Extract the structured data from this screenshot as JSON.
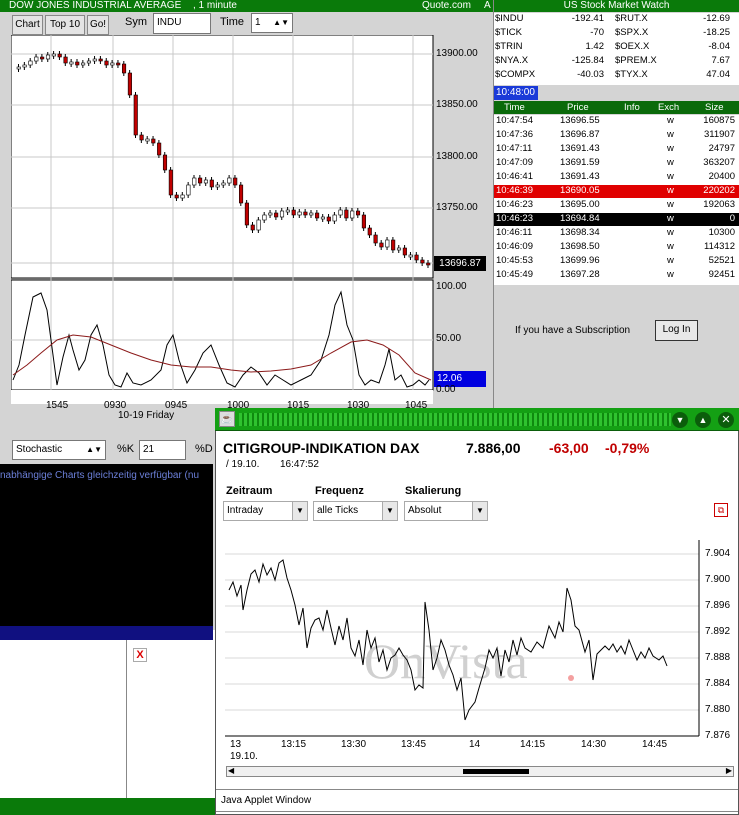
{
  "chart_window": {
    "title": "DOW JONES INDUSTRIAL AVERAGE",
    "interval": ", 1 minute",
    "source": "Quote.com",
    "source_suffix": "A",
    "toolbar": {
      "chart_btn": "Chart",
      "top10_btn": "Top 10",
      "go_btn": "Go!",
      "sym_label": "Sym",
      "sym_value": "INDU",
      "time_label": "Time",
      "time_value": "1"
    },
    "price_ticks": [
      "13900.00",
      "13850.00",
      "13800.00",
      "13750.00"
    ],
    "last_price": "13696.87",
    "osc_ticks": [
      "100.00",
      "50.00",
      "0.00"
    ],
    "osc_value": "12.06",
    "x_ticks": [
      "1545",
      "0930",
      "0945",
      "1000",
      "1015",
      "1030",
      "1045"
    ],
    "date_label": "10-19 Friday",
    "indicator": {
      "name": "Stochastic",
      "k_label": "%K",
      "k_value": "21",
      "d_label": "%D"
    },
    "info_text": "nabhängige Charts gleichzeitig verfügbar (nu"
  },
  "market_watch": {
    "title": "US Stock Market Watch",
    "rows": [
      {
        "s1": "$INDU",
        "v1": "-192.41",
        "s2": "$RUT.X",
        "v2": "-12.69"
      },
      {
        "s1": "$TICK",
        "v1": "-70",
        "s2": "$SPX.X",
        "v2": "-18.25"
      },
      {
        "s1": "$TRIN",
        "v1": "1.42",
        "s2": "$OEX.X",
        "v2": "-8.04"
      },
      {
        "s1": "$NYA.X",
        "v1": "-125.84",
        "s2": "$PREM.X",
        "v2": "7.67"
      },
      {
        "s1": "$COMPX",
        "v1": "-40.03",
        "s2": "$TYX.X",
        "v2": "47.04"
      }
    ],
    "clock": "10:48:00",
    "headers": [
      "Time",
      "Price",
      "Info",
      "Exch",
      "Size"
    ],
    "trades": [
      {
        "time": "10:47:54",
        "price": "13696.55",
        "exch": "w",
        "size": "160875",
        "hl": ""
      },
      {
        "time": "10:47:36",
        "price": "13696.87",
        "exch": "w",
        "size": "311907",
        "hl": ""
      },
      {
        "time": "10:47:11",
        "price": "13691.43",
        "exch": "w",
        "size": "24797",
        "hl": ""
      },
      {
        "time": "10:47:09",
        "price": "13691.59",
        "exch": "w",
        "size": "363207",
        "hl": ""
      },
      {
        "time": "10:46:41",
        "price": "13691.43",
        "exch": "w",
        "size": "20400",
        "hl": ""
      },
      {
        "time": "10:46:39",
        "price": "13690.05",
        "exch": "w",
        "size": "220202",
        "hl": "red"
      },
      {
        "time": "10:46:23",
        "price": "13695.00",
        "exch": "w",
        "size": "192063",
        "hl": ""
      },
      {
        "time": "10:46:23",
        "price": "13694.84",
        "exch": "w",
        "size": "0",
        "hl": "black"
      },
      {
        "time": "10:46:11",
        "price": "13698.34",
        "exch": "w",
        "size": "10300",
        "hl": ""
      },
      {
        "time": "10:46:09",
        "price": "13698.50",
        "exch": "w",
        "size": "114312",
        "hl": ""
      },
      {
        "time": "10:45:53",
        "price": "13699.96",
        "exch": "w",
        "size": "52521",
        "hl": ""
      },
      {
        "time": "10:45:49",
        "price": "13697.28",
        "exch": "w",
        "size": "92451",
        "hl": ""
      }
    ],
    "subscription_text": "If you have a Subscription",
    "login_label": "Log In"
  },
  "dax_window": {
    "title": "CITIGROUP-INDIKATION DAX",
    "price": "7.886,00",
    "change": "-63,00",
    "change_pct": "-0,79%",
    "date": "/ 19.10.",
    "time": "16:47:52",
    "controls": [
      {
        "label": "Zeitraum",
        "value": "Intraday"
      },
      {
        "label": "Frequenz",
        "value": "alle Ticks"
      },
      {
        "label": "Skalierung",
        "value": "Absolut"
      }
    ],
    "y_ticks": [
      "7.904",
      "7.900",
      "7.896",
      "7.892",
      "7.888",
      "7.884",
      "7.880",
      "7.876"
    ],
    "x_ticks": [
      "13",
      "13:15",
      "13:30",
      "13:45",
      "14",
      "14:15",
      "14:30",
      "14:45"
    ],
    "x_date": "19.10.",
    "watermark": "OnVista",
    "status": "Java Applet Window"
  }
}
